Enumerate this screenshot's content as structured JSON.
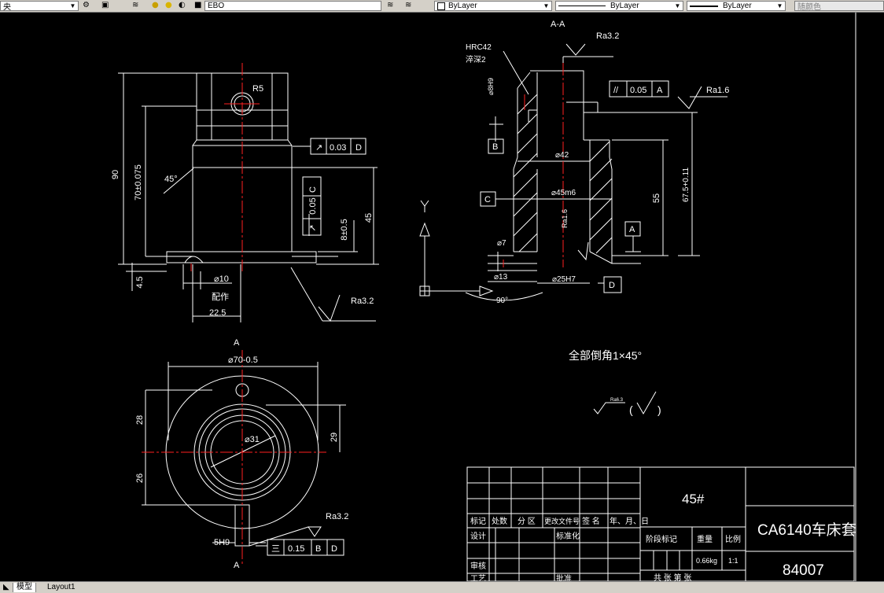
{
  "toolbar": {
    "layer_value": "EBO",
    "color_value": "ByLayer",
    "linetype_value": "ByLayer",
    "lineweight_value": "ByLayer",
    "plotstyle_value": "随颜色"
  },
  "tabs": {
    "model": "模型",
    "layout1": "Layout1"
  },
  "drawing": {
    "section_label": "A-A",
    "roughness": {
      "ra32": "Ra3.2",
      "ra16": "Ra1.6",
      "ra63": "Ra6.3"
    },
    "notes": {
      "hrc": "HRC42",
      "depth": "淬深2",
      "chamfer": "全部倒角1×45°",
      "paren_open": "(",
      "paren_close": ")",
      "peizuo": "配作"
    },
    "tolerances": {
      "runout_d": {
        "symbol": "↗",
        "value": "0.03",
        "datum": "D"
      },
      "runout_c": {
        "symbol": "↗",
        "value": "0.05",
        "datum": "C"
      },
      "parallel_a": {
        "symbol": "//",
        "value": "0.05",
        "datum": "A"
      },
      "sym_bd": {
        "symbol": "三",
        "value": "0.15",
        "datum1": "B",
        "datum2": "D"
      }
    },
    "datums": {
      "a": "A",
      "b": "B",
      "c": "C",
      "d": "D",
      "y": "Y"
    },
    "dims": {
      "d90": "90",
      "d70": "70±0.075",
      "d45deg": "45°",
      "r5": "R5",
      "d45": "45",
      "d8": "8±0.5",
      "d45h": "4.5",
      "d10": "⌀10",
      "d225": "22.5",
      "dphi70": "⌀70-0.5",
      "d28": "28",
      "d26": "26",
      "d29": "29",
      "dphi31": "⌀31",
      "d5h9": "5H9",
      "dphi42": "⌀42",
      "dphi45m6": "⌀45m6",
      "d55": "55",
      "d675": "67.5+0.11",
      "dphi7": "⌀7",
      "dphi13": "⌀13",
      "dphi25h7": "⌀25H7",
      "d90deg": "90°",
      "dphi8": "⌀8H9"
    },
    "titleblock": {
      "material": "45#",
      "name": "CA6140车床套",
      "number": "84007",
      "headers": [
        "标记",
        "处数",
        "分 区",
        "更改文件号",
        "签 名",
        "年、月、日"
      ],
      "design": "设计",
      "standard": "标准化",
      "review": "审核",
      "process": "工艺",
      "approve": "批准",
      "stage": "阶段标记",
      "weight": "重量",
      "scale": "比例",
      "weight_value": "0.66kg",
      "scale_value": "1:1",
      "sheets": "共   张   第   张"
    }
  }
}
